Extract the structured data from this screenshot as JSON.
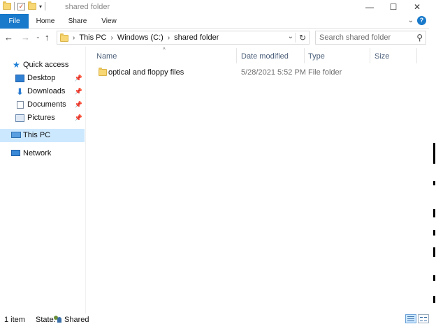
{
  "window": {
    "title": "shared folder",
    "controls": {
      "minimize": "—",
      "maximize": "☐",
      "close": "✕"
    }
  },
  "ribbon": {
    "tabs": [
      {
        "label": "File"
      },
      {
        "label": "Home"
      },
      {
        "label": "Share"
      },
      {
        "label": "View"
      }
    ],
    "help_label": "?",
    "accent": "#1979ca"
  },
  "address": {
    "crumbs": [
      "This PC",
      "Windows (C:)",
      "shared folder"
    ]
  },
  "search": {
    "placeholder": "Search shared folder"
  },
  "nav_pane": {
    "quick_access": "Quick access",
    "items": [
      {
        "label": "Desktop",
        "icon": "desktop-icon",
        "pinned": true
      },
      {
        "label": "Downloads",
        "icon": "downloads-icon",
        "pinned": true
      },
      {
        "label": "Documents",
        "icon": "documents-icon",
        "pinned": true
      },
      {
        "label": "Pictures",
        "icon": "pictures-icon",
        "pinned": true
      }
    ],
    "this_pc": "This PC",
    "network": "Network",
    "selected_color": "#cce8ff"
  },
  "columns": {
    "name": "Name",
    "date_modified": "Date modified",
    "type": "Type",
    "size": "Size"
  },
  "files": [
    {
      "name": "optical and floppy files",
      "date_modified": "5/28/2021 5:52 PM",
      "type": "File folder",
      "size": ""
    }
  ],
  "status": {
    "count": "1 item",
    "state_label": "State:",
    "state_value": "Shared"
  }
}
